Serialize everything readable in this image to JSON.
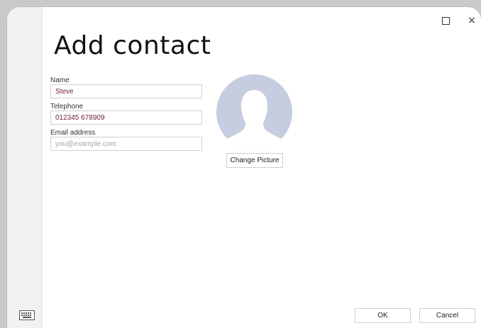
{
  "window": {
    "maximize_icon": "maximize-icon",
    "close_glyph": "×"
  },
  "page_title": "Add contact",
  "form": {
    "name": {
      "label": "Name",
      "value": "Steve",
      "placeholder": ""
    },
    "telephone": {
      "label": "Telephone",
      "value": "012345 678909",
      "placeholder": ""
    },
    "email": {
      "label": "Email address",
      "value": "",
      "placeholder": "you@example.com"
    }
  },
  "avatar": {
    "icon": "person-silhouette-icon"
  },
  "buttons": {
    "change_picture": "Change Picture",
    "ok": "OK",
    "cancel": "Cancel"
  },
  "taskbar": {
    "keyboard_icon": "keyboard-icon"
  },
  "colors": {
    "avatar_bg": "#c6cde0",
    "input_text": "#6b1f3a"
  }
}
